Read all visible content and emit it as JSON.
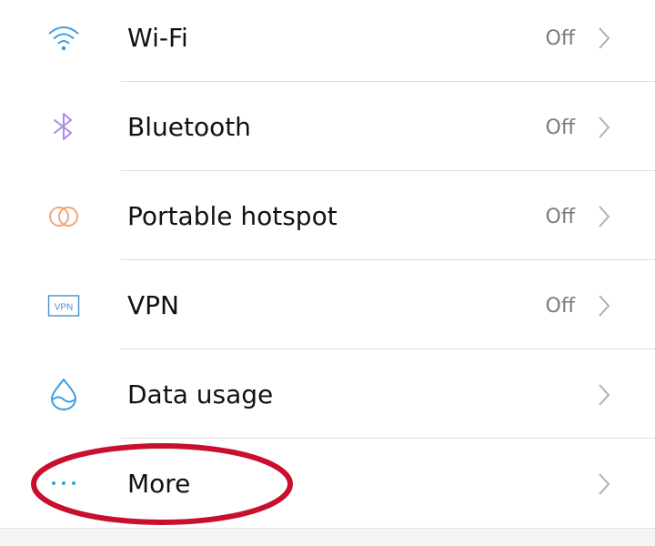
{
  "settings": {
    "items": [
      {
        "label": "Wi-Fi",
        "value": "Off",
        "icon": "wifi-icon"
      },
      {
        "label": "Bluetooth",
        "value": "Off",
        "icon": "bluetooth-icon"
      },
      {
        "label": "Portable hotspot",
        "value": "Off",
        "icon": "hotspot-icon"
      },
      {
        "label": "VPN",
        "value": "Off",
        "icon": "vpn-icon",
        "icon_text": "VPN"
      },
      {
        "label": "Data usage",
        "icon": "water-drop-icon"
      },
      {
        "label": "More",
        "icon": "more-dots-icon"
      }
    ]
  },
  "colors": {
    "wifi": "#3a9fe0",
    "bluetooth": "#a98be8",
    "hotspot": "#f0a777",
    "vpn": "#4a8fd0",
    "data_usage": "#3aa0dd",
    "more": "#3aa0dd",
    "annotation": "#c8102e",
    "chevron": "#b0b0b0"
  }
}
